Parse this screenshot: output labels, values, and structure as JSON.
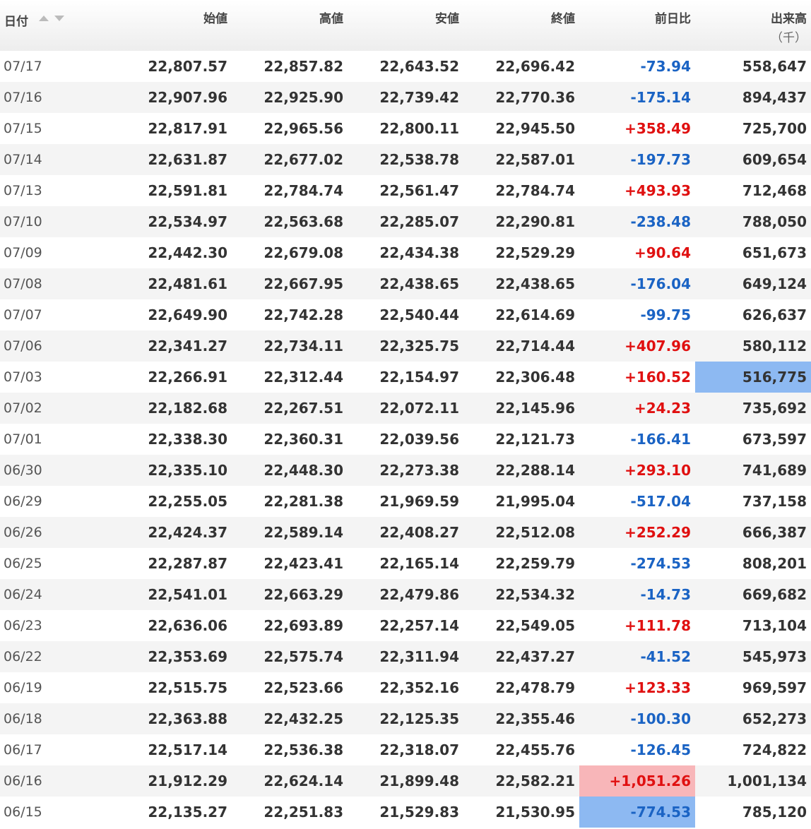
{
  "columns": {
    "date": "日付",
    "open": "始値",
    "high": "高値",
    "low": "安値",
    "close": "終値",
    "change": "前日比",
    "volume": "出来高",
    "volume_unit": "（千）"
  },
  "colors": {
    "up": "#e01010",
    "down": "#1a63c4",
    "highlight_blue": "#8db9f2",
    "highlight_red": "#f8b6b9"
  },
  "sort_icons": [
    "sort-ascending-icon",
    "sort-descending-icon"
  ],
  "rows": [
    {
      "date": "07/17",
      "open": "22,807.57",
      "high": "22,857.82",
      "low": "22,643.52",
      "close": "22,696.42",
      "change": "-73.94",
      "volume": "558,647"
    },
    {
      "date": "07/16",
      "open": "22,907.96",
      "high": "22,925.90",
      "low": "22,739.42",
      "close": "22,770.36",
      "change": "-175.14",
      "volume": "894,437"
    },
    {
      "date": "07/15",
      "open": "22,817.91",
      "high": "22,965.56",
      "low": "22,800.11",
      "close": "22,945.50",
      "change": "+358.49",
      "volume": "725,700"
    },
    {
      "date": "07/14",
      "open": "22,631.87",
      "high": "22,677.02",
      "low": "22,538.78",
      "close": "22,587.01",
      "change": "-197.73",
      "volume": "609,654"
    },
    {
      "date": "07/13",
      "open": "22,591.81",
      "high": "22,784.74",
      "low": "22,561.47",
      "close": "22,784.74",
      "change": "+493.93",
      "volume": "712,468"
    },
    {
      "date": "07/10",
      "open": "22,534.97",
      "high": "22,563.68",
      "low": "22,285.07",
      "close": "22,290.81",
      "change": "-238.48",
      "volume": "788,050"
    },
    {
      "date": "07/09",
      "open": "22,442.30",
      "high": "22,679.08",
      "low": "22,434.38",
      "close": "22,529.29",
      "change": "+90.64",
      "volume": "651,673"
    },
    {
      "date": "07/08",
      "open": "22,481.61",
      "high": "22,667.95",
      "low": "22,438.65",
      "close": "22,438.65",
      "change": "-176.04",
      "volume": "649,124"
    },
    {
      "date": "07/07",
      "open": "22,649.90",
      "high": "22,742.28",
      "low": "22,540.44",
      "close": "22,614.69",
      "change": "-99.75",
      "volume": "626,637"
    },
    {
      "date": "07/06",
      "open": "22,341.27",
      "high": "22,734.11",
      "low": "22,325.75",
      "close": "22,714.44",
      "change": "+407.96",
      "volume": "580,112"
    },
    {
      "date": "07/03",
      "open": "22,266.91",
      "high": "22,312.44",
      "low": "22,154.97",
      "close": "22,306.48",
      "change": "+160.52",
      "volume": "516,775",
      "volume_hl": "blue"
    },
    {
      "date": "07/02",
      "open": "22,182.68",
      "high": "22,267.51",
      "low": "22,072.11",
      "close": "22,145.96",
      "change": "+24.23",
      "volume": "735,692"
    },
    {
      "date": "07/01",
      "open": "22,338.30",
      "high": "22,360.31",
      "low": "22,039.56",
      "close": "22,121.73",
      "change": "-166.41",
      "volume": "673,597"
    },
    {
      "date": "06/30",
      "open": "22,335.10",
      "high": "22,448.30",
      "low": "22,273.38",
      "close": "22,288.14",
      "change": "+293.10",
      "volume": "741,689"
    },
    {
      "date": "06/29",
      "open": "22,255.05",
      "high": "22,281.38",
      "low": "21,969.59",
      "close": "21,995.04",
      "change": "-517.04",
      "volume": "737,158"
    },
    {
      "date": "06/26",
      "open": "22,424.37",
      "high": "22,589.14",
      "low": "22,408.27",
      "close": "22,512.08",
      "change": "+252.29",
      "volume": "666,387"
    },
    {
      "date": "06/25",
      "open": "22,287.87",
      "high": "22,423.41",
      "low": "22,165.14",
      "close": "22,259.79",
      "change": "-274.53",
      "volume": "808,201"
    },
    {
      "date": "06/24",
      "open": "22,541.01",
      "high": "22,663.29",
      "low": "22,479.86",
      "close": "22,534.32",
      "change": "-14.73",
      "volume": "669,682"
    },
    {
      "date": "06/23",
      "open": "22,636.06",
      "high": "22,693.89",
      "low": "22,257.14",
      "close": "22,549.05",
      "change": "+111.78",
      "volume": "713,104"
    },
    {
      "date": "06/22",
      "open": "22,353.69",
      "high": "22,575.74",
      "low": "22,311.94",
      "close": "22,437.27",
      "change": "-41.52",
      "volume": "545,973"
    },
    {
      "date": "06/19",
      "open": "22,515.75",
      "high": "22,523.66",
      "low": "22,352.16",
      "close": "22,478.79",
      "change": "+123.33",
      "volume": "969,597"
    },
    {
      "date": "06/18",
      "open": "22,363.88",
      "high": "22,432.25",
      "low": "22,125.35",
      "close": "22,355.46",
      "change": "-100.30",
      "volume": "652,273"
    },
    {
      "date": "06/17",
      "open": "22,517.14",
      "high": "22,536.38",
      "low": "22,318.07",
      "close": "22,455.76",
      "change": "-126.45",
      "volume": "724,822"
    },
    {
      "date": "06/16",
      "open": "21,912.29",
      "high": "22,624.14",
      "low": "21,899.48",
      "close": "22,582.21",
      "change": "+1,051.26",
      "volume": "1,001,134",
      "change_hl": "red"
    },
    {
      "date": "06/15",
      "open": "22,135.27",
      "high": "22,251.83",
      "low": "21,529.83",
      "close": "21,530.95",
      "change": "-774.53",
      "volume": "785,120",
      "change_hl": "blue"
    }
  ]
}
